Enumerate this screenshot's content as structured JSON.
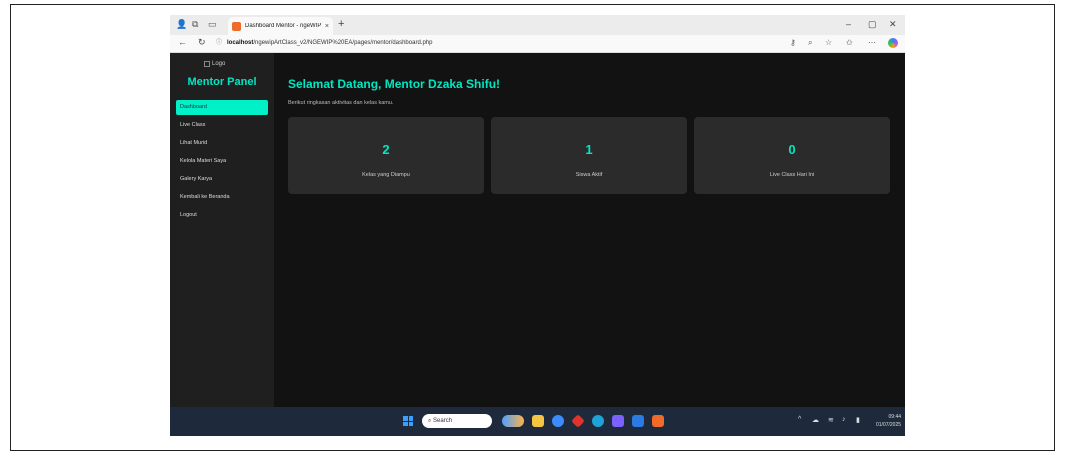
{
  "browser": {
    "tab_title": "Dashboard Mentor - ngeWIP Art",
    "tab_close": "×",
    "new_tab": "+",
    "window_controls": {
      "minimize": "–",
      "restore": "▢",
      "close": "✕"
    },
    "url_host": "localhost",
    "url_path": "/ngewipArtClass_v2/NGEWIP%20EA/pages/mentor/dashboard.php"
  },
  "sidebar": {
    "logo_alt": "Logo",
    "panel_title": "Mentor Panel",
    "items": [
      {
        "label": "Dashboard",
        "active": true
      },
      {
        "label": "Live Class"
      },
      {
        "label": "Lihat Murid"
      },
      {
        "label": "Kelola Materi Saya"
      },
      {
        "label": "Galery Karya"
      },
      {
        "label": "Kembali ke Beranda"
      },
      {
        "label": "Logout"
      }
    ]
  },
  "main": {
    "welcome": "Selamat Datang, Mentor Dzaka Shifu!",
    "subtitle": "Berikut ringkasan aktivitas dan kelas kamu.",
    "stats": [
      {
        "value": "2",
        "label": "Kelas yang Diampu"
      },
      {
        "value": "1",
        "label": "Siswa Aktif"
      },
      {
        "value": "0",
        "label": "Live Class Hari Ini"
      }
    ]
  },
  "taskbar": {
    "search_label": "Search",
    "time": "09:44",
    "date": "01/07/2025"
  },
  "colors": {
    "accent": "#00e6c3",
    "page_bg": "#121212",
    "sidebar_bg": "#1f1f1f",
    "card_bg": "#2b2b2b",
    "active_item_bg": "#00f0c8"
  }
}
